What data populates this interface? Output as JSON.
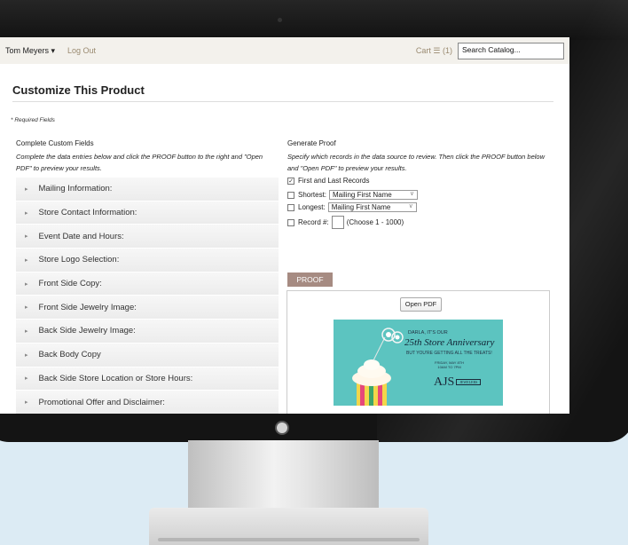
{
  "topbar": {
    "user_menu": "Tom Meyers ▾",
    "logout": "Log Out",
    "cart": "Cart ☰ (1)",
    "search_placeholder": "Search Catalog..."
  },
  "page": {
    "title": "Customize This Product",
    "required_note": "* Required Fields"
  },
  "left": {
    "heading": "Complete Custom Fields",
    "description": "Complete the data entries below and click the PROOF button to the right and \"Open PDF\" to preview your results.",
    "sections": [
      "Mailing Information:",
      "Store Contact Information:",
      "Event Date and Hours:",
      "Store Logo Selection:",
      "Front Side Copy:",
      "Front Side Jewelry Image:",
      "Back Side Jewelry Image:",
      "Back Body Copy",
      "Back Side Store Location or Store Hours:",
      "Promotional Offer and Disclaimer:"
    ]
  },
  "right": {
    "heading": "Generate Proof",
    "description": "Specify which records in the data source to review. Then click the PROOF button below and \"Open PDF\" to preview your results.",
    "first_last_label": "First and Last Records",
    "first_last_checked": true,
    "shortest_label": "Shortest:",
    "shortest_value": "Mailing First Name",
    "longest_label": "Longest:",
    "longest_value": "Mailing First Name",
    "record_label": "Record #:",
    "record_range": "(Choose 1 - 1000)",
    "proof_button": "PROOF",
    "open_pdf_button": "Open PDF"
  },
  "preview": {
    "line1": "DARLA, IT'S OUR",
    "line2": "25th Store Anniversary",
    "line3": "BUT YOU'RE GETTING ALL THE TREATS!",
    "line4a": "FRIDAY, MAY 8TH",
    "line4b": "10AM TO 7PM",
    "logo": "AJS",
    "logo_sub": "JEWELERS"
  },
  "colors": {
    "proof_button": "#a68b82",
    "card_background": "#5cc4c0",
    "link": "#9a8a70"
  }
}
